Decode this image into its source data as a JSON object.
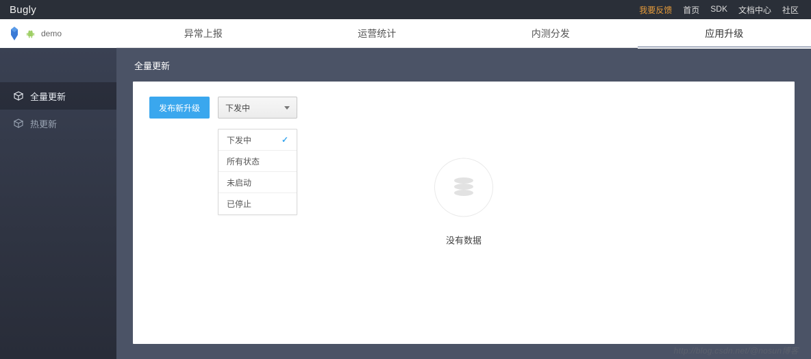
{
  "topbar": {
    "brand": "Bugly",
    "links": {
      "feedback": "我要反馈",
      "home": "首页",
      "sdk": "SDK",
      "docs": "文档中心",
      "community": "社区"
    }
  },
  "app": {
    "name": "demo"
  },
  "sidebar": {
    "items": [
      {
        "label": "全量更新",
        "active": true
      },
      {
        "label": "热更新",
        "active": false
      }
    ]
  },
  "tabs": {
    "items": [
      {
        "label": "异常上报",
        "active": false
      },
      {
        "label": "运营统计",
        "active": false
      },
      {
        "label": "内测分发",
        "active": false
      },
      {
        "label": "应用升级",
        "active": true
      }
    ]
  },
  "section": {
    "title": "全量更新"
  },
  "controls": {
    "publish_button": "发布新升级",
    "status_select": {
      "selected": "下发中",
      "options": [
        "下发中",
        "所有状态",
        "未启动",
        "已停止"
      ]
    }
  },
  "empty": {
    "text": "没有数据"
  },
  "watermark": "http://blog.csdn.net/@nosun博客"
}
